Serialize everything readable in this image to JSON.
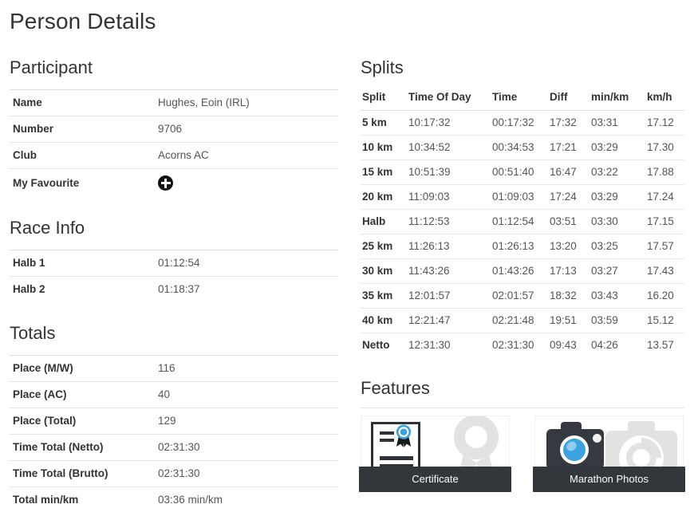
{
  "page": {
    "title": "Person Details"
  },
  "participant": {
    "heading": "Participant",
    "rows": [
      {
        "label": "Name",
        "value": "Hughes, Eoin (IRL)"
      },
      {
        "label": "Number",
        "value": "9706"
      },
      {
        "label": "Club",
        "value": "Acorns AC"
      }
    ],
    "favourite_label": "My Favourite",
    "favourite_icon": "plus-circle-icon"
  },
  "race_info": {
    "heading": "Race Info",
    "rows": [
      {
        "label": "Halb 1",
        "value": "01:12:54"
      },
      {
        "label": "Halb 2",
        "value": "01:18:37"
      }
    ]
  },
  "totals": {
    "heading": "Totals",
    "rows": [
      {
        "label": "Place (M/W)",
        "value": "116"
      },
      {
        "label": "Place (AC)",
        "value": "40"
      },
      {
        "label": "Place (Total)",
        "value": "129"
      },
      {
        "label": "Time Total (Netto)",
        "value": "02:31:30"
      },
      {
        "label": "Time Total (Brutto)",
        "value": "02:31:30"
      },
      {
        "label": "Total min/km",
        "value": "03:36 min/km"
      }
    ]
  },
  "splits": {
    "heading": "Splits",
    "columns": [
      "Split",
      "Time Of Day",
      "Time",
      "Diff",
      "min/km",
      "km/h"
    ],
    "rows": [
      {
        "split": "5 km",
        "time_of_day": "10:17:32",
        "time": "00:17:32",
        "diff": "17:32",
        "min_km": "03:31",
        "km_h": "17.12"
      },
      {
        "split": "10 km",
        "time_of_day": "10:34:52",
        "time": "00:34:53",
        "diff": "17:21",
        "min_km": "03:29",
        "km_h": "17.30"
      },
      {
        "split": "15 km",
        "time_of_day": "10:51:39",
        "time": "00:51:40",
        "diff": "16:47",
        "min_km": "03:22",
        "km_h": "17.88"
      },
      {
        "split": "20 km",
        "time_of_day": "11:09:03",
        "time": "01:09:03",
        "diff": "17:24",
        "min_km": "03:29",
        "km_h": "17.24"
      },
      {
        "split": "Halb",
        "time_of_day": "11:12:53",
        "time": "01:12:54",
        "diff": "03:51",
        "min_km": "03:30",
        "km_h": "17.15"
      },
      {
        "split": "25 km",
        "time_of_day": "11:26:13",
        "time": "01:26:13",
        "diff": "13:20",
        "min_km": "03:25",
        "km_h": "17.57"
      },
      {
        "split": "30 km",
        "time_of_day": "11:43:26",
        "time": "01:43:26",
        "diff": "17:13",
        "min_km": "03:27",
        "km_h": "17.43"
      },
      {
        "split": "35 km",
        "time_of_day": "12:01:57",
        "time": "02:01:57",
        "diff": "18:32",
        "min_km": "03:43",
        "km_h": "16.20"
      },
      {
        "split": "40 km",
        "time_of_day": "12:21:47",
        "time": "02:21:48",
        "diff": "19:51",
        "min_km": "03:59",
        "km_h": "15.12"
      },
      {
        "split": "Netto",
        "time_of_day": "12:31:30",
        "time": "02:31:30",
        "diff": "09:43",
        "min_km": "04:26",
        "km_h": "13.57"
      }
    ]
  },
  "features": {
    "heading": "Features",
    "tiles": [
      {
        "label": "Certificate",
        "icon": "certificate-icon"
      },
      {
        "label": "Marathon Photos",
        "icon": "camera-icon"
      }
    ]
  },
  "colors": {
    "accent_blue": "#3ba3e0",
    "button_dark": "#32373c",
    "text": "#333333",
    "value_text": "#555555",
    "rule": "#e4e4e4",
    "watermark": "#e0e0e0"
  }
}
